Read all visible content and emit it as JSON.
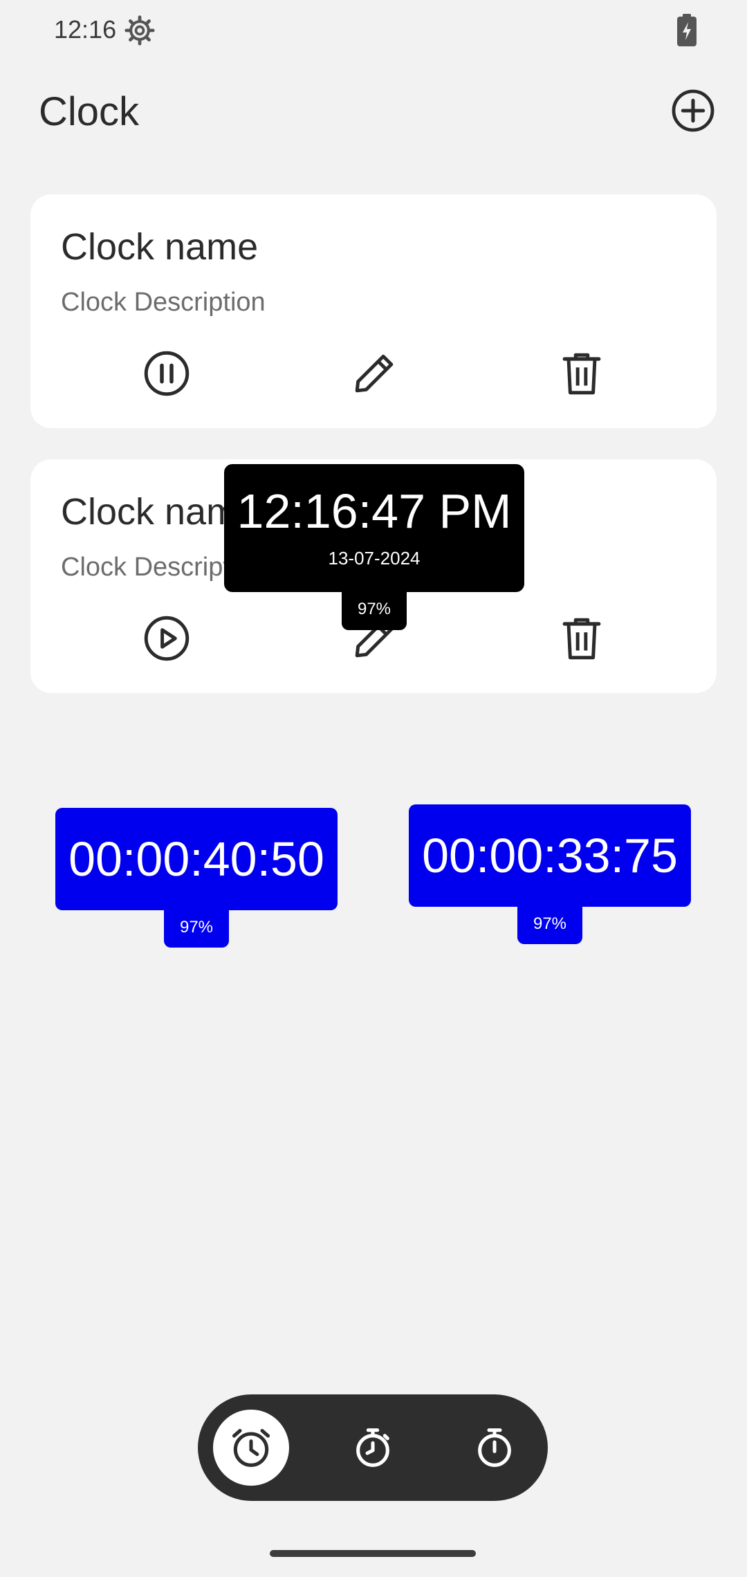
{
  "status_bar": {
    "time": "12:16",
    "gear_icon": "gear-icon",
    "battery_icon": "battery-charging-icon"
  },
  "header": {
    "title": "Clock",
    "add_icon": "add-circle-icon"
  },
  "cards": [
    {
      "title": "Clock name",
      "description": "Clock Description",
      "primary_icon": "pause-circle-icon",
      "edit_icon": "pencil-icon",
      "delete_icon": "trash-icon"
    },
    {
      "title": "Clock name",
      "description": "Clock Description",
      "primary_icon": "play-circle-icon",
      "edit_icon": "pencil-icon",
      "delete_icon": "trash-icon"
    }
  ],
  "floating_clock": {
    "time": "12:16:47 PM",
    "date": "13-07-2024",
    "battery": "97%"
  },
  "stopwatches": [
    {
      "time": "00:00:40:50",
      "battery": "97%"
    },
    {
      "time": "00:00:33:75",
      "battery": "97%"
    }
  ],
  "bottom_nav": {
    "items": [
      {
        "icon": "alarm-clock-icon",
        "active": true
      },
      {
        "icon": "stopwatch-icon",
        "active": false
      },
      {
        "icon": "timer-icon",
        "active": false
      }
    ]
  },
  "colors": {
    "background": "#f2f2f2",
    "card": "#ffffff",
    "stopwatch_widget": "#0000ee",
    "clock_widget": "#000000",
    "nav_bar": "#2e2e2e"
  }
}
